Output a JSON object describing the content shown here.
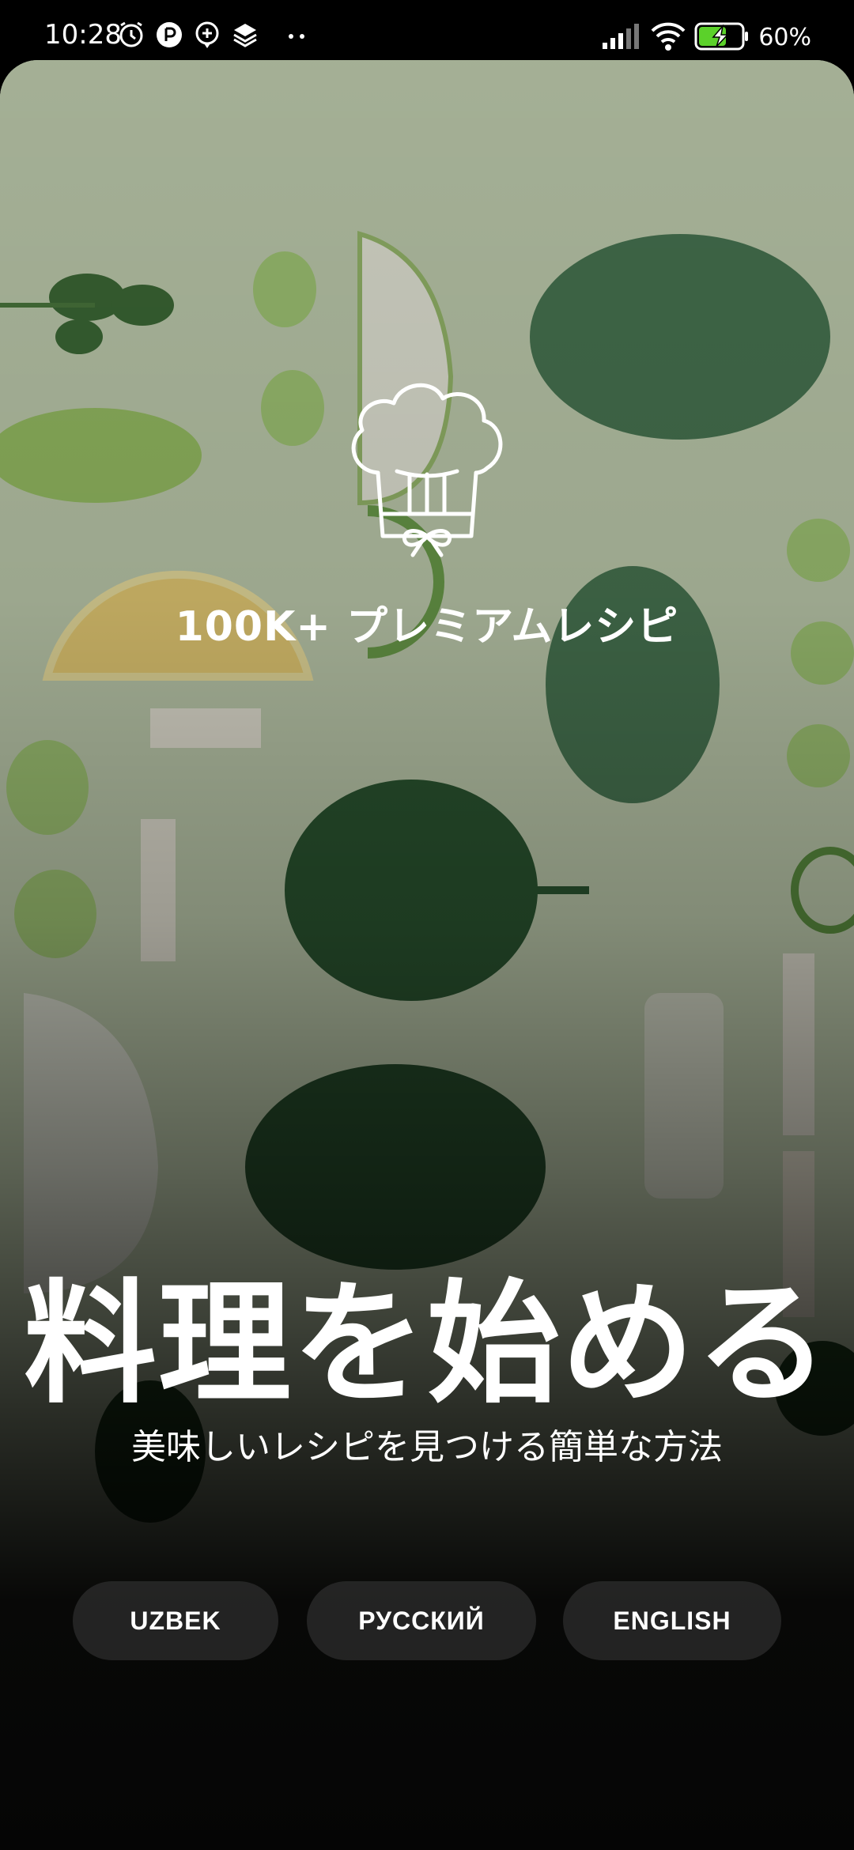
{
  "status_bar": {
    "time": "10:28",
    "battery_percent": "60%",
    "icons": [
      "alarm-icon",
      "app-notification-icon",
      "message-plus-icon",
      "layers-icon",
      "more-dots-icon",
      "signal-icon",
      "wifi-icon",
      "battery-charging-icon"
    ]
  },
  "hero": {
    "logo": "chef-hat-icon",
    "tagline": "100K+ プレミアムレシピ",
    "title": "料理を始める",
    "subtitle": "美味しいレシピを見つける簡単な方法"
  },
  "languages": [
    "UZBEK",
    "РУССКИЙ",
    "ENGLISH"
  ],
  "colors": {
    "background": "#000000",
    "button_bg": "#3a3a3a",
    "text": "#ffffff",
    "battery_fill": "#5bd12a"
  }
}
